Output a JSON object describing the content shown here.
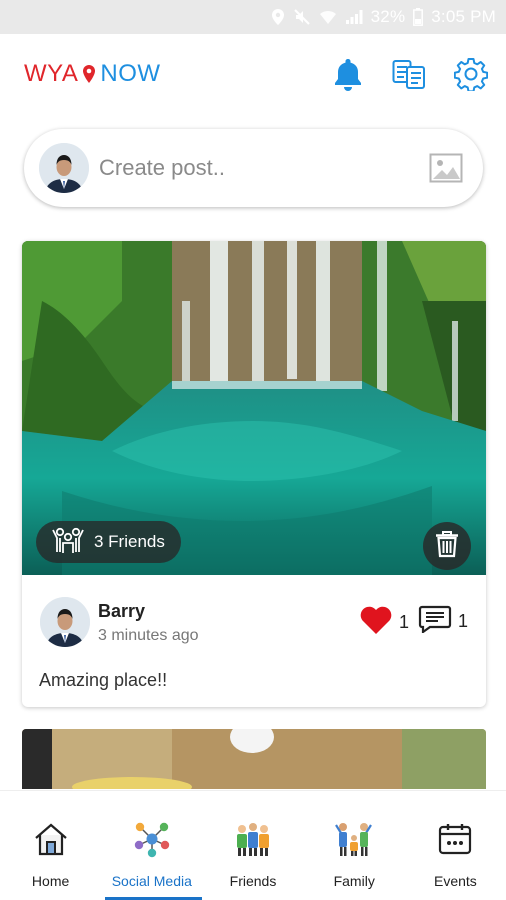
{
  "status_bar": {
    "battery": "32%",
    "time": "3:05 PM",
    "icons": [
      "location-icon",
      "mute-icon",
      "wifi-icon",
      "signal-icon",
      "battery-icon"
    ]
  },
  "header": {
    "logo_left": "WYA",
    "logo_right": "NOW",
    "logo_colors": {
      "left": "#e0262b",
      "right": "#1e8fe0"
    },
    "icons": [
      "bell-icon",
      "translate-icon",
      "gear-icon"
    ],
    "accent_color": "#1e8fe0"
  },
  "create_post": {
    "placeholder": "Create post..",
    "icon": "image-icon"
  },
  "post": {
    "friends_tag": "3 Friends",
    "author": "Barry",
    "time": "3 minutes ago",
    "likes": "1",
    "comments": "1",
    "caption": "Amazing place!!",
    "icons": [
      "group-icon",
      "trash-icon",
      "heart-icon",
      "comment-icon"
    ]
  },
  "bottom_nav": {
    "items": [
      {
        "label": "Home",
        "icon": "home-icon"
      },
      {
        "label": "Social Media",
        "icon": "social-network-icon",
        "active": true
      },
      {
        "label": "Friends",
        "icon": "friends-icon"
      },
      {
        "label": "Family",
        "icon": "family-icon"
      },
      {
        "label": "Events",
        "icon": "calendar-icon"
      }
    ],
    "active_color": "#1a73c8"
  }
}
